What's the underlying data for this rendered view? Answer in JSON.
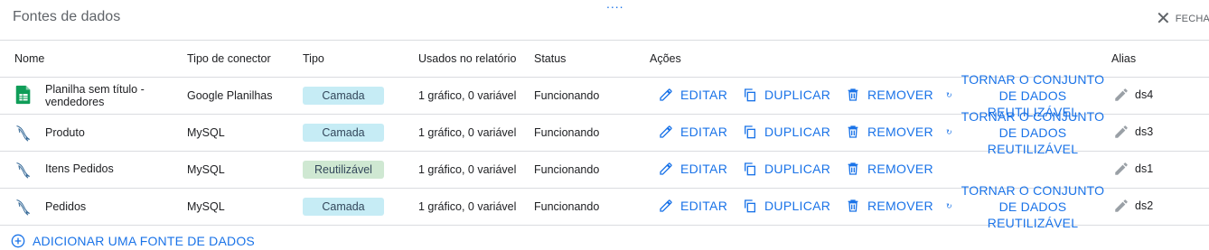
{
  "panel": {
    "title": "Fontes de dados",
    "drag_handle": "....",
    "close_label": "FECHA"
  },
  "table": {
    "columns": {
      "name": "Nome",
      "connector": "Tipo de conector",
      "type": "Tipo",
      "used": "Usados no relatório",
      "status": "Status",
      "actions": "Ações",
      "alias": "Alias"
    },
    "rows": [
      {
        "icon": "google-sheets-icon",
        "name_line1": "Planilha sem título -",
        "name_line2": "vendedores",
        "connector": "Google Planilhas",
        "type": "Camada",
        "used": "1 gráfico, 0 variável",
        "status": "Funcionando",
        "edit": "EDITAR",
        "duplicate": "DUPLICAR",
        "remove": "REMOVER",
        "make_reusable": "TORNAR O CONJUNTO DE DADOS REUTILIZÁVEL",
        "alias": "ds4"
      },
      {
        "icon": "mysql-dolphin-icon",
        "name": "Produto",
        "connector": "MySQL",
        "type": "Camada",
        "used": "1 gráfico, 0 variável",
        "status": "Funcionando",
        "edit": "EDITAR",
        "duplicate": "DUPLICAR",
        "remove": "REMOVER",
        "make_reusable": "TORNAR O CONJUNTO DE DADOS REUTILIZÁVEL",
        "alias": "ds3"
      },
      {
        "icon": "mysql-dolphin-icon",
        "name": "Itens Pedidos",
        "connector": "MySQL",
        "type": "Reutilizável",
        "used": "1 gráfico, 0 variável",
        "status": "Funcionando",
        "edit": "EDITAR",
        "duplicate": "DUPLICAR",
        "remove": "REMOVER",
        "alias": "ds1"
      },
      {
        "icon": "mysql-dolphin-icon",
        "name": "Pedidos",
        "connector": "MySQL",
        "type": "Camada",
        "used": "1 gráfico, 0 variável",
        "status": "Funcionando",
        "edit": "EDITAR",
        "duplicate": "DUPLICAR",
        "remove": "REMOVER",
        "make_reusable": "TORNAR O CONJUNTO DE DADOS REUTILIZÁVEL",
        "alias": "ds2"
      }
    ]
  },
  "footer": {
    "add_source": "ADICIONAR UMA FONTE DE DADOS"
  },
  "colors": {
    "accent": "#1a73e8",
    "layer_badge": "#c6ecf5",
    "reusable_badge": "#cfe8d2",
    "sheets_green": "#0f9d58"
  }
}
